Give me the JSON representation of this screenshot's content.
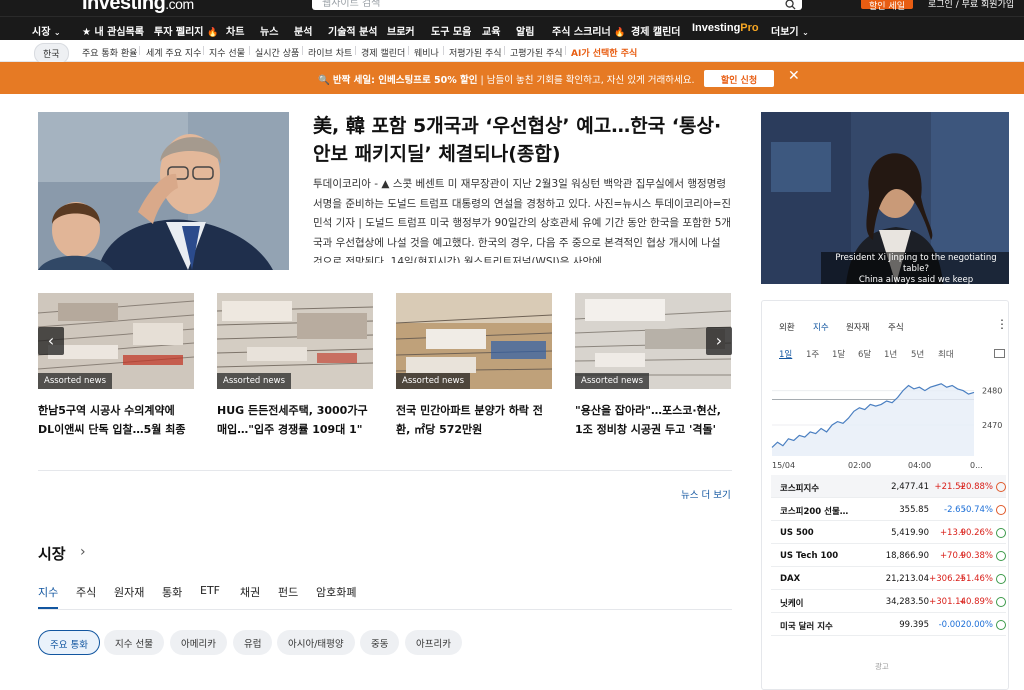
{
  "header": {
    "logo": "Investing",
    "logo_suffix": ".com",
    "search_placeholder": "웹사이트 검색",
    "promo_button": "할인 세일",
    "login": "로그인  /  무료 회원가입"
  },
  "nav": {
    "items": [
      "시장",
      "내 관심목록",
      "투자 펠리지",
      "차트",
      "뉴스",
      "분석",
      "기술적 분석",
      "브로커",
      "도구 모음",
      "교육",
      "알림",
      "주식 스크리너",
      "경제 캘린더",
      "InvestingPro",
      "더보기"
    ],
    "pro_suffix": "Pro"
  },
  "subnav": {
    "items": [
      "한국",
      "주요 통화 환율",
      "세계 주요 지수",
      "지수 선물",
      "실시간 상품",
      "라이브 차트",
      "경제 캘린더",
      "웨비나",
      "저평가된 주식",
      "고평가된 주식",
      "AI가 선택한 주식"
    ]
  },
  "banner": {
    "bold": "반짝 세일: 인베스팅프로 50% 할인",
    "text": " | 남들이 놓친 기회를 확인하고, 자신 있게 거래하세요.",
    "button": "할인 신청"
  },
  "hero": {
    "title": "美, 韓 포함 5개국과 ‘우선협상’ 예고…한국 ‘통상·안보 패키지딜’ 체결되나(종합)",
    "body": "투데이코리아 - ▲ 스콧 베센트 미 재무장관이 지난 2월3일 워싱턴 백악관 집무실에서 행정명령 서명을 준비하는 도널드 트럼프 대통령의 연설을 경청하고 있다. 사진=뉴시스 투데이코리아=진민석 기자 | 도널드 트럼프 미국 행정부가 90일간의 상호관세 유예 기간 동안 한국을 포함한 5개국과 우선협상에 나설 것을 예고했다. 한국의 경우, 다음 주 중으로 본격적인 협상 개시에 나설 것으로 전망된다. 14일(현지시간) 월스트리트저널(WSJ)은 사안에 ..."
  },
  "news_cards": [
    {
      "tag": "Assorted news",
      "title": "한남5구역 시공사 수의계약에 DL이앤씨 단독 입찰…5월 최종 선정"
    },
    {
      "tag": "Assorted news",
      "title": "HUG 든든전세주택, 3000가구 매입…\"입주 경쟁률 109대 1\""
    },
    {
      "tag": "Assorted news",
      "title": "전국 민간아파트 분양가 하락 전환, ㎡당 572만원"
    },
    {
      "tag": "Assorted news",
      "title": "\"용산을 잡아라\"…포스코·현산, 1조 정비창 시공권 두고 '격돌'"
    }
  ],
  "more_news": "뉴스 더 보기",
  "market": {
    "title": "시장",
    "tabs": [
      "지수",
      "주식",
      "원자재",
      "통화",
      "ETF",
      "채권",
      "펀드",
      "암호화폐"
    ],
    "pills": [
      "주요 통화",
      "지수 선물",
      "아메리카",
      "유럽",
      "아시아/태평양",
      "중동",
      "아프리카"
    ]
  },
  "video": {
    "caption_1": "President Xi Jinping to the negotiating table?",
    "caption_2": "China always said we keep"
  },
  "panel": {
    "tabs": [
      "외환",
      "지수",
      "원자재",
      "주식"
    ],
    "ranges": [
      "1일",
      "1주",
      "1달",
      "6달",
      "1년",
      "5년",
      "최대"
    ],
    "ad_label": "광고",
    "quotes": [
      {
        "name": "코스피지수",
        "price": "2,477.41",
        "change": "+21.52",
        "pct": "+0.88%",
        "dir": "up",
        "clock": "#e05a2b"
      },
      {
        "name": "코스피200 선물…",
        "price": "355.85",
        "change": "-2.65",
        "pct": "-0.74%",
        "dir": "dn",
        "clock": "#e05a2b"
      },
      {
        "name": "US 500",
        "price": "5,419.90",
        "change": "+13.9",
        "pct": "+0.26%",
        "dir": "up",
        "clock": "#3c9a4a"
      },
      {
        "name": "US Tech 100",
        "price": "18,866.90",
        "change": "+70.9",
        "pct": "+0.38%",
        "dir": "up",
        "clock": "#3c9a4a"
      },
      {
        "name": "DAX",
        "price": "21,213.04",
        "change": "+306.25",
        "pct": "+1.46%",
        "dir": "up",
        "clock": "#3c9a4a"
      },
      {
        "name": "닛케이",
        "price": "34,283.50",
        "change": "+301.14",
        "pct": "+0.89%",
        "dir": "up",
        "clock": "#3c9a4a"
      },
      {
        "name": "미국 달러 지수",
        "price": "99.395",
        "change": "-0.002",
        "pct": "0.00%",
        "dir": "dn",
        "clock": "#3c9a4a"
      }
    ]
  },
  "chart_data": {
    "type": "line",
    "x_ticks": [
      "15/04",
      "02:00",
      "04:00",
      "0..."
    ],
    "y_ticks": [
      2480,
      2470
    ],
    "values": [
      2463.5,
      2465,
      2464,
      2466,
      2465.5,
      2467,
      2466.5,
      2468,
      2467.5,
      2469,
      2468,
      2470,
      2471,
      2470.5,
      2472,
      2474,
      2475,
      2474.5,
      2476,
      2475.5,
      2476,
      2477,
      2476.5,
      2478,
      2480,
      2481.5,
      2480.5,
      2481,
      2480,
      2481,
      2481.5,
      2482,
      2481,
      2481.5,
      2480.5,
      2480,
      2479,
      2479.5
    ],
    "reference_line": 2477.41,
    "ylim": [
      2461,
      2486
    ]
  }
}
